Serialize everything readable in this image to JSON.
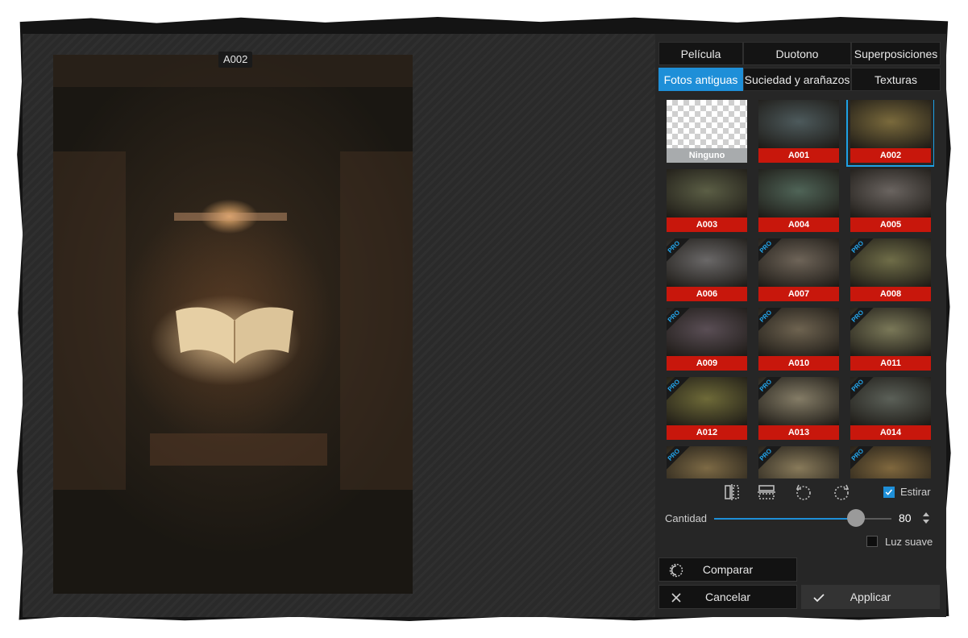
{
  "image_label": "A002",
  "tabs_row1": [
    {
      "label": "Película",
      "active": false
    },
    {
      "label": "Duotono",
      "active": false
    },
    {
      "label": "Superposiciones",
      "active": false
    }
  ],
  "tabs_row2": [
    {
      "label": "Fotos antiguas",
      "active": true
    },
    {
      "label": "Suciedad y arañazos",
      "active": false
    },
    {
      "label": "Texturas",
      "active": false
    }
  ],
  "thumbnails": [
    {
      "label": "Ninguno",
      "pro": false,
      "selected": false,
      "color": "checker"
    },
    {
      "label": "A001",
      "pro": false,
      "selected": false,
      "color": "#4d5a5c"
    },
    {
      "label": "A002",
      "pro": false,
      "selected": true,
      "color": "#7a6a3c"
    },
    {
      "label": "A003",
      "pro": false,
      "selected": false,
      "color": "#5b5e45"
    },
    {
      "label": "A004",
      "pro": false,
      "selected": false,
      "color": "#4f6457"
    },
    {
      "label": "A005",
      "pro": false,
      "selected": false,
      "color": "#6a6460"
    },
    {
      "label": "A006",
      "pro": true,
      "selected": false,
      "color": "#6a6868"
    },
    {
      "label": "A007",
      "pro": true,
      "selected": false,
      "color": "#6e6458"
    },
    {
      "label": "A008",
      "pro": true,
      "selected": false,
      "color": "#6f6d48"
    },
    {
      "label": "A009",
      "pro": true,
      "selected": false,
      "color": "#5a4e55"
    },
    {
      "label": "A010",
      "pro": true,
      "selected": false,
      "color": "#6e6350"
    },
    {
      "label": "A011",
      "pro": true,
      "selected": false,
      "color": "#7a7858"
    },
    {
      "label": "A012",
      "pro": true,
      "selected": false,
      "color": "#6e6a38"
    },
    {
      "label": "A013",
      "pro": true,
      "selected": false,
      "color": "#847c66"
    },
    {
      "label": "A014",
      "pro": true,
      "selected": false,
      "color": "#5b6058"
    },
    {
      "label": "",
      "pro": true,
      "selected": false,
      "color": "#7d6a45"
    },
    {
      "label": "",
      "pro": true,
      "selected": false,
      "color": "#887a5a"
    },
    {
      "label": "",
      "pro": true,
      "selected": false,
      "color": "#80683e"
    }
  ],
  "controls": {
    "stretch_label": "Estirar",
    "stretch_checked": true,
    "amount_label": "Cantidad",
    "amount_value": "80",
    "amount_fraction": 0.8,
    "soft_light_label": "Luz suave",
    "soft_light_checked": false
  },
  "buttons": {
    "compare": "Comparar",
    "cancel": "Cancelar",
    "apply": "Applicar"
  },
  "colors": {
    "accent": "#1e8fd8",
    "label_red": "#c8170c"
  }
}
